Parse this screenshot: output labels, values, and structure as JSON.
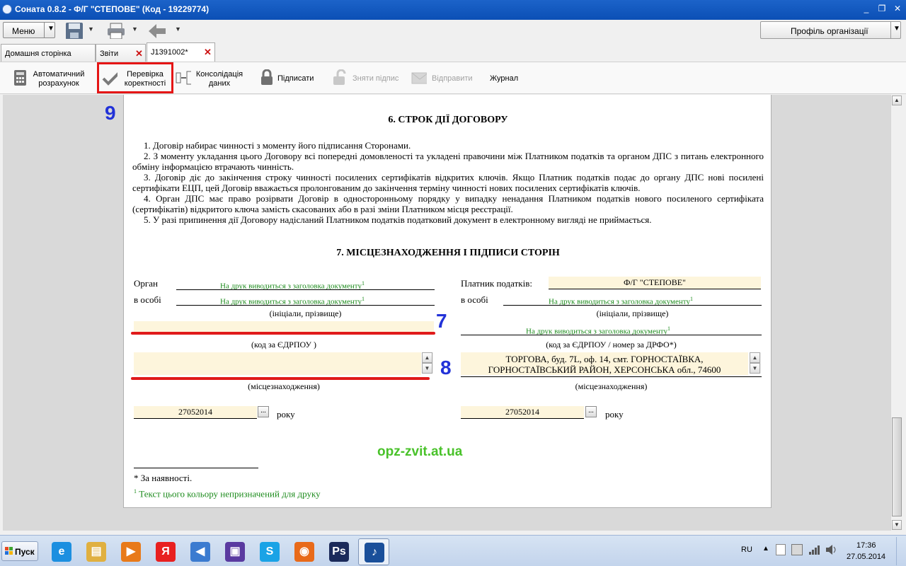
{
  "window": {
    "title": "Соната 0.8.2 - Ф/Г \"СТЕПОВЕ\" (Код - 19229774)",
    "minimize": "_",
    "restore": "❐",
    "close": "✕"
  },
  "toolbar": {
    "menu_label": "Меню",
    "profile_label": "Профіль організації"
  },
  "tabs": [
    {
      "label": "Домашня сторінка"
    },
    {
      "label": "Звіти"
    },
    {
      "label": "J1391002*"
    }
  ],
  "actions": [
    {
      "label": "Автоматичний розрахунок"
    },
    {
      "label": "Перевірка коректності"
    },
    {
      "label": "Консолідація даних"
    },
    {
      "label": "Підписати"
    },
    {
      "label": "Зняти підпис"
    },
    {
      "label": "Відправити"
    },
    {
      "label": "Журнал"
    }
  ],
  "document": {
    "section6_title": "6. СТРОК ДІЇ ДОГОВОРУ",
    "section6_items": [
      "1. Договір набирає чинності з моменту його підписання Сторонами.",
      "2. З моменту укладання цього Договору всі попередні домовленості та укладені правочини між Платником податків та органом ДПС з питань електронного обміну інформацією втрачають чинність.",
      "3. Договір діє до закінчення строку чинності посилених сертифікатів відкритих ключів. Якщо Платник податків подає до органу ДПС нові посилені сертифікати ЕЦП, цей Договір вважається пролонгованим до закінчення терміну чинності нових посилених сертифікатів ключів.",
      "4. Орган ДПС має право розірвати Договір в односторонньому порядку у випадку ненадання Платником податків нового посиленого сертифіката (сертифікатів) відкритого ключа замість скасованих або в разі зміни Платником місця реєстрації.",
      "5. У разі припинення дії Договору надісланий Платником податків податковий документ в електронному вигляді не приймається."
    ],
    "section7_title": "7. МІСЦЕЗНАХОДЖЕННЯ І ПІДПИСИ СТОРІН",
    "left": {
      "organ_label": "Орган",
      "person_label": "в особі",
      "print_hint": "На друк виводиться з заголовка документу",
      "initials_caption": "(ініціали, прізвище)",
      "edrpou_caption": "(код за ЄДРПОУ )",
      "edrpou_value": "",
      "location_value": "",
      "location_caption": "(місцезнаходження)",
      "date_value": "27052014",
      "year_label": "року"
    },
    "right": {
      "payer_label": "Платник податків:",
      "payer_value": "Ф/Г \"СТЕПОВЕ\"",
      "person_label": "в особі",
      "print_hint": "На друк виводиться з заголовка документу",
      "initials_caption": "(ініціали, прізвище)",
      "edrpou_caption": "(код за ЄДРПОУ / номер за ДРФО*)",
      "location_line1": "ТОРГОВА, буд. 7L, оф. 14, смт. ГОРНОСТАЇВКА,",
      "location_line2": "ГОРНОСТАЇВСЬКИЙ РАЙОН, ХЕРСОНСЬКА обл., 74600",
      "location_caption": "(місцезнаходження)",
      "date_value": "27052014",
      "year_label": "року"
    },
    "sup_mark": "1",
    "dots": "...",
    "watermark": "opz-zvit.at.ua",
    "footnote_star": "* За наявності.",
    "footnote_green": "Текст цього кольору непризначений для друку"
  },
  "annotations": {
    "n9": "9",
    "n7": "7",
    "n8": "8"
  },
  "taskbar": {
    "start_label": "Пуск",
    "lang": "RU",
    "time": "17:36",
    "date": "27.05.2014",
    "apps": [
      {
        "icon": "ie-icon",
        "glyph": "e",
        "color": "#1c8fe0"
      },
      {
        "icon": "explorer-icon",
        "glyph": "▤",
        "color": "#e0b040"
      },
      {
        "icon": "media-player-icon",
        "glyph": "▶",
        "color": "#e87a1a"
      },
      {
        "icon": "yandex-icon",
        "glyph": "Я",
        "color": "#e82020"
      },
      {
        "icon": "volume-app-icon",
        "glyph": "◀",
        "color": "#3b7bd0"
      },
      {
        "icon": "floppy-app-icon",
        "glyph": "▣",
        "color": "#5a3aa0"
      },
      {
        "icon": "skype-icon",
        "glyph": "S",
        "color": "#1aa3e6"
      },
      {
        "icon": "firefox-icon",
        "glyph": "◉",
        "color": "#e86a1a"
      },
      {
        "icon": "photoshop-icon",
        "glyph": "Ps",
        "color": "#1b2a5a"
      },
      {
        "icon": "sonata-icon",
        "glyph": "♪",
        "color": "#1a4f9a"
      }
    ]
  },
  "colors": {
    "title_bar": "#0b4fb5",
    "highlight": "#e51515",
    "annotation_blue": "#2232d8",
    "field_yellow": "#fdf5dc",
    "print_hint_green": "#1a8a1a",
    "watermark_green": "#49c22a"
  }
}
